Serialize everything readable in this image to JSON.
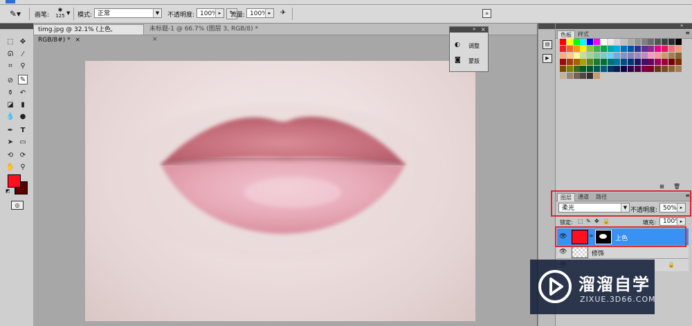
{
  "options_bar": {
    "brush_label": "画笔:",
    "brush_size": "125",
    "mode_label": "模式:",
    "mode_value": "正常",
    "opacity_label": "不透明度:",
    "opacity_value": "100%",
    "flow_label": "流量:",
    "flow_value": "100%"
  },
  "document_tabs": [
    {
      "label": "timg.jpg @ 32.1% (上色, RGB/8#) *",
      "active": true
    },
    {
      "label": "未标题-1 @ 66.7% (图层 3, RGB/8) *",
      "active": false
    }
  ],
  "adjustments_panel": {
    "items": [
      "调整",
      "蒙版"
    ]
  },
  "swatches_panel": {
    "tabs": [
      "色板",
      "样式"
    ],
    "colors": [
      "#ff0000",
      "#ffff00",
      "#00ff00",
      "#00ffff",
      "#0000ff",
      "#ff00ff",
      "#ffffff",
      "#ebebeb",
      "#d6d6d6",
      "#c0c0c0",
      "#aaaaaa",
      "#959595",
      "#808080",
      "#6b6b6b",
      "#555555",
      "#404040",
      "#2b2b2b",
      "#000000",
      "#ee1d24",
      "#f16522",
      "#f7941d",
      "#fff200",
      "#8dc63f",
      "#39b54a",
      "#00a651",
      "#00a99d",
      "#00aeef",
      "#0072bc",
      "#0054a6",
      "#2e3192",
      "#662d91",
      "#92278f",
      "#ec008c",
      "#ed145b",
      "#f26d7d",
      "#f69679",
      "#f9ad81",
      "#fdc68a",
      "#fff799",
      "#c4df9b",
      "#a3d39c",
      "#82ca9c",
      "#7accc8",
      "#6dcff6",
      "#7da7d9",
      "#8393ca",
      "#8781bd",
      "#a187be",
      "#bd8cbf",
      "#f49ac1",
      "#f5989d",
      "#c69c6d",
      "#a67c52",
      "#8c6239",
      "#9e0b0f",
      "#a0410d",
      "#a36209",
      "#aba000",
      "#598527",
      "#1a7b30",
      "#007236",
      "#00746b",
      "#0076a3",
      "#004b80",
      "#003471",
      "#1b1464",
      "#440e62",
      "#630460",
      "#9e005d",
      "#9e0039",
      "#790000",
      "#7b2e00",
      "#7d4900",
      "#827b00",
      "#406618",
      "#005e20",
      "#005826",
      "#005952",
      "#005b7f",
      "#003663",
      "#002157",
      "#0d004c",
      "#32004b",
      "#4b0049",
      "#7b0046",
      "#7a0026",
      "#603913",
      "#754c24",
      "#8c6239",
      "#a67c52",
      "#c7b299",
      "#998675",
      "#736357",
      "#534741",
      "#362f2d",
      "#c69c6d"
    ]
  },
  "layers_panel": {
    "tabs": [
      "图层",
      "通道",
      "路径"
    ],
    "blend_mode": "柔光",
    "opacity_label": "不透明度:",
    "opacity_value": "50%",
    "lock_label": "锁定:",
    "fill_label": "填充:",
    "fill_value": "100%",
    "layers": [
      {
        "name": "上色",
        "selected": true
      },
      {
        "name": "修饰",
        "selected": false
      }
    ]
  },
  "watermark": {
    "name": "溜溜自学",
    "url": "ZIXUE.3D66.COM"
  },
  "colors": {
    "foreground": "#ff1020",
    "background": "#5a0000",
    "selection": "#3a91f4",
    "highlight_box": "#d9272d"
  }
}
